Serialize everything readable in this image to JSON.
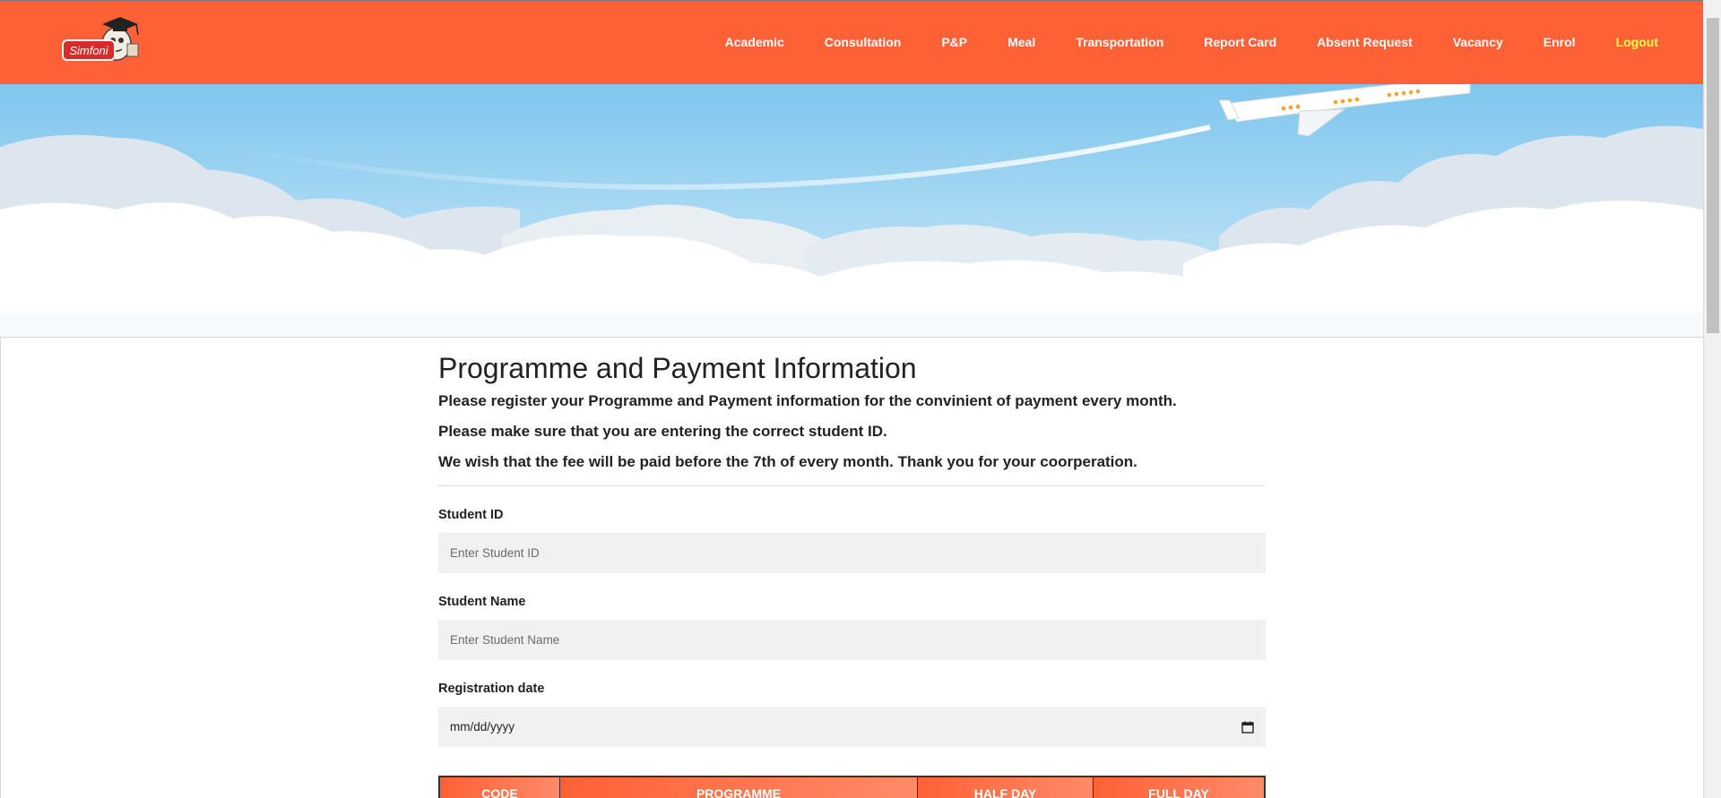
{
  "nav": {
    "logo_text": "Simfoni",
    "items": [
      {
        "label": "Academic"
      },
      {
        "label": "Consultation"
      },
      {
        "label": "P&P"
      },
      {
        "label": "Meal"
      },
      {
        "label": "Transportation"
      },
      {
        "label": "Report Card"
      },
      {
        "label": "Absent Request"
      },
      {
        "label": "Vacancy"
      },
      {
        "label": "Enrol"
      }
    ],
    "logout_label": "Logout"
  },
  "colors": {
    "navbar": "#ff6136",
    "logout": "#ffff4d",
    "field_bg": "#f1f1f1"
  },
  "form": {
    "title": "Programme and Payment Information",
    "intro": [
      "Please register your Programme and Payment information for the convinient of payment every month.",
      "Please make sure that you are entering the correct student ID.",
      "We wish that the fee will be paid before the 7th of every month. Thank you for your coorperation."
    ],
    "student_id_label": "Student ID",
    "student_id_placeholder": "Enter Student ID",
    "student_name_label": "Student Name",
    "student_name_placeholder": "Enter Student Name",
    "registration_date_label": "Registration date",
    "registration_date_placeholder": "mm/dd/yyyy",
    "table_headers": [
      "CODE",
      "PROGRAMME",
      "HALF DAY",
      "FULL DAY"
    ]
  }
}
